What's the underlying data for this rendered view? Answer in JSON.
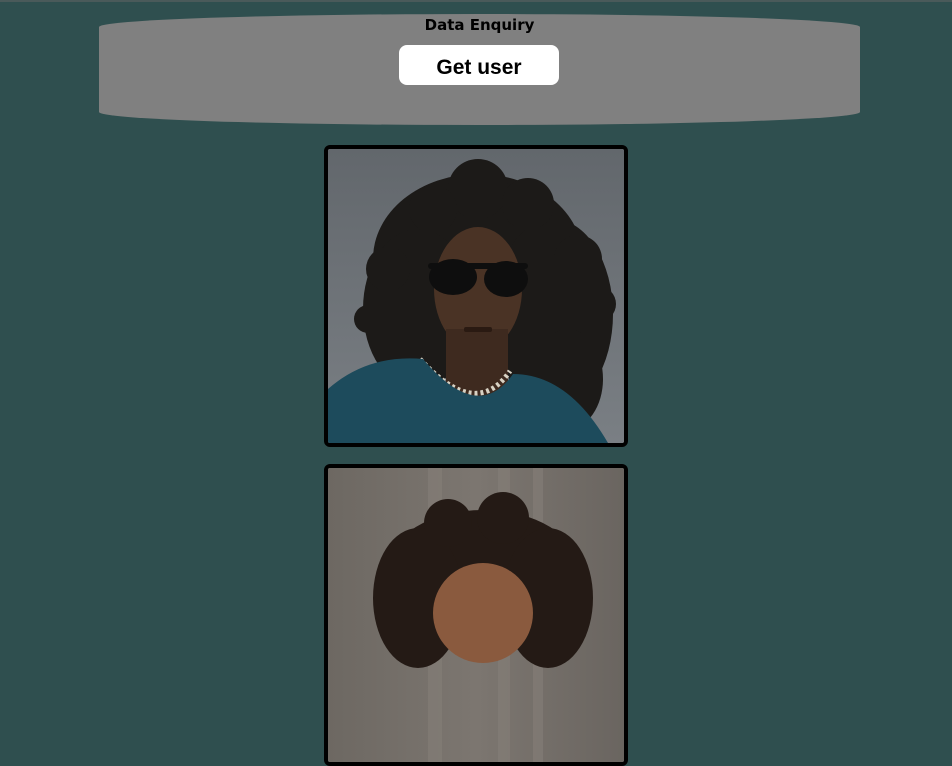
{
  "header": {
    "title": "Data Enquiry",
    "button_label": "Get user"
  },
  "users": [
    {
      "photo_alt": "user-photo-1"
    },
    {
      "photo_alt": "user-photo-2"
    }
  ],
  "colors": {
    "background": "#2f4f4f",
    "header_bg": "#808080",
    "button_bg": "#ffffff",
    "card_border": "#000000"
  }
}
